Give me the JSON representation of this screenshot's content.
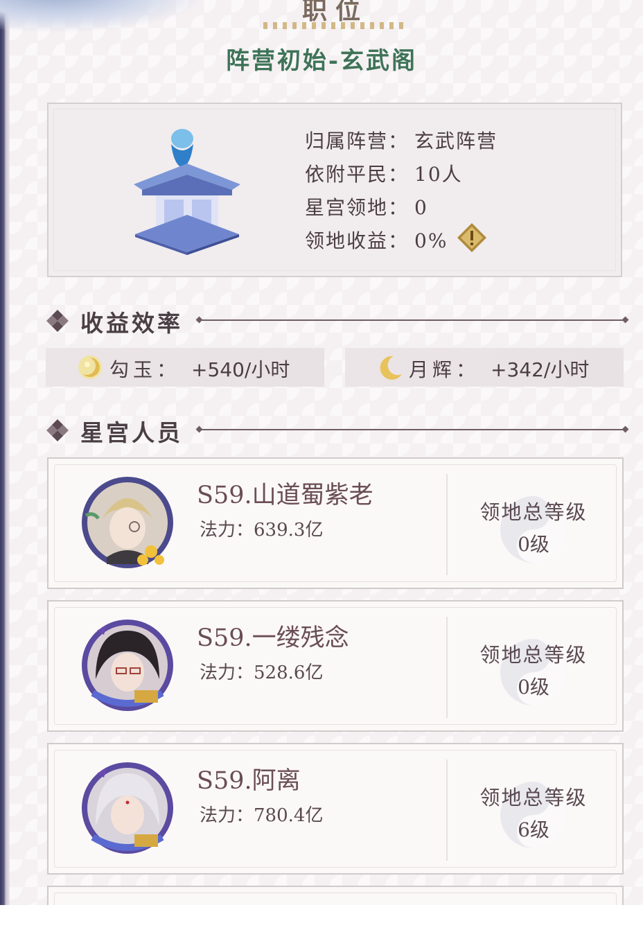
{
  "header": {
    "top_title": "职位",
    "title": "阵营初始-玄武阁"
  },
  "info": {
    "rows": [
      {
        "label": "归属阵营：",
        "value": "玄武阵营"
      },
      {
        "label": "依附平民：",
        "value": "10人"
      },
      {
        "label": "星宫领地：",
        "value": "0"
      },
      {
        "label": "领地收益：",
        "value": "0%"
      }
    ],
    "icons": [
      "pavilion-icon",
      "warning-diamond-icon"
    ]
  },
  "income_section": {
    "title": "收益效率",
    "items": [
      {
        "icon": "jade-icon",
        "label": "勾玉：",
        "value": "+540/小时"
      },
      {
        "icon": "moon-icon",
        "label": "月辉：",
        "value": "+342/小时"
      }
    ]
  },
  "members_section": {
    "title": "星宫人员",
    "members": [
      {
        "name": "S59.山道蜀紫老",
        "power_label": "法力：",
        "power": "639.3亿",
        "level_label": "领地总等级",
        "level": "0级"
      },
      {
        "name": "S59.一缕残念",
        "power_label": "法力：",
        "power": "528.6亿",
        "level_label": "领地总等级",
        "level": "0级"
      },
      {
        "name": "S59.阿离",
        "power_label": "法力：",
        "power": "780.4亿",
        "level_label": "领地总等级",
        "level": "6级"
      }
    ]
  },
  "colors": {
    "title_green": "#3e7358",
    "text_dark": "#4b3e43",
    "name_color": "#6a4d55",
    "gold": "#c8a96a"
  }
}
